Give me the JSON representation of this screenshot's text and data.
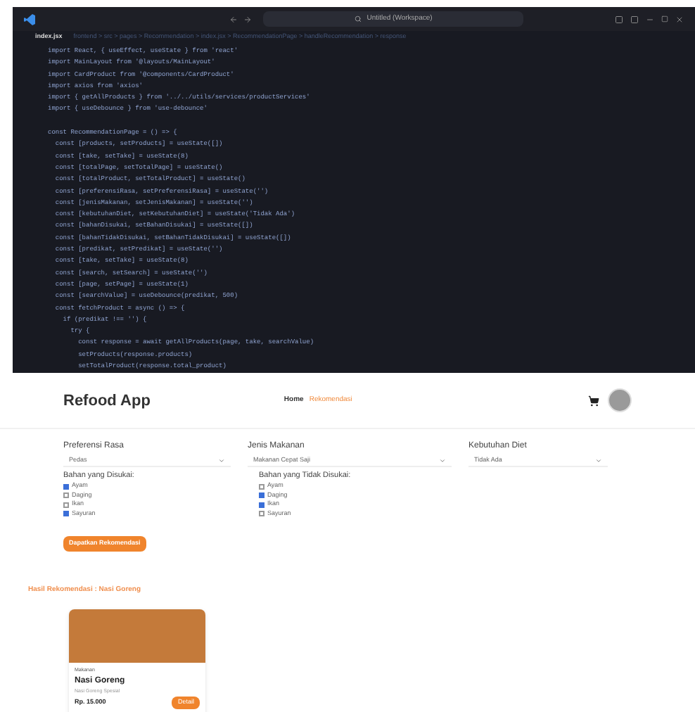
{
  "editor": {
    "search": "Untitled (Workspace)",
    "tab": "index.jsx",
    "breadcrumb": "frontend > src > pages > Recommendation > index.jsx > RecommendationPage > handleRecommendation > response",
    "blocks": [
      [
        "import React, { useEffect, useState } from 'react'",
        "import MainLayout from '@layouts/MainLayout'",
        "import CardProduct from '@components/CardProduct'",
        "import axios from 'axios'",
        "import { getAllProducts } from '../../utils/services/productServices'",
        "import { useDebounce } from 'use-debounce'"
      ],
      [
        "const RecommendationPage = () => {",
        "  const [products, setProducts] = useState([])",
        "  const [take, setTake] = useState(8)",
        "  const [totalPage, setTotalPage] = useState()",
        "  const [totalProduct, setTotalProduct] = useState()",
        "  const [preferensiRasa, setPreferensiRasa] = useState('')",
        "  const [jenisMakanan, setJenisMakanan] = useState('')",
        "  const [kebutuhanDiet, setKebutuhanDiet] = useState('Tidak Ada')",
        "  const [bahanDisukai, setBahanDisukai] = useState([])",
        "  const [bahanTidakDisukai, setBahanTidakDisukai] = useState([])",
        "  const [predikat, setPredikat] = useState('')",
        "  const [take, setTake] = useState(8)",
        "  const [search, setSearch] = useState('')",
        "  const [page, setPage] = useState(1)",
        "  const [searchValue] = useDebounce(predikat, 500)",
        "  const fetchProduct = async () => {",
        "    if (predikat !== '') {",
        "      try {",
        "        const response = await getAllProducts(page, take, searchValue)",
        "        setProducts(response.products)",
        "        setTotalProduct(response.total_product)"
      ]
    ]
  },
  "app": {
    "brand": "Refood App",
    "nav": [
      {
        "label": "Home",
        "selected": false
      },
      {
        "label": "Rekomendasi",
        "selected": true
      }
    ],
    "filters": [
      {
        "label": "Preferensi Rasa",
        "value": "Pedas"
      },
      {
        "label": "Jenis Makanan",
        "value": "Makanan Cepat Saji"
      },
      {
        "label": "Kebutuhan Diet",
        "value": "Tidak Ada"
      }
    ],
    "groups": [
      {
        "title": "Bahan yang Disukai:",
        "items": [
          {
            "label": "Ayam",
            "checked": true
          },
          {
            "label": "Daging",
            "checked": false
          },
          {
            "label": "Ikan",
            "checked": false
          },
          {
            "label": "Sayuran",
            "checked": true
          }
        ]
      },
      {
        "title": "Bahan yang Tidak Disukai:",
        "items": [
          {
            "label": "Ayam",
            "checked": false
          },
          {
            "label": "Daging",
            "checked": true
          },
          {
            "label": "Ikan",
            "checked": true
          },
          {
            "label": "Sayuran",
            "checked": false
          }
        ]
      }
    ],
    "submit": "Dapatkan Rekomendasi",
    "result_title": "Hasil Rekomendasi : Nasi Goreng",
    "card": {
      "category": "Makanan",
      "name": "Nasi Goreng",
      "description": "Nasi Goreng Spesial",
      "price": "Rp. 15.000",
      "button": "Detail"
    }
  }
}
